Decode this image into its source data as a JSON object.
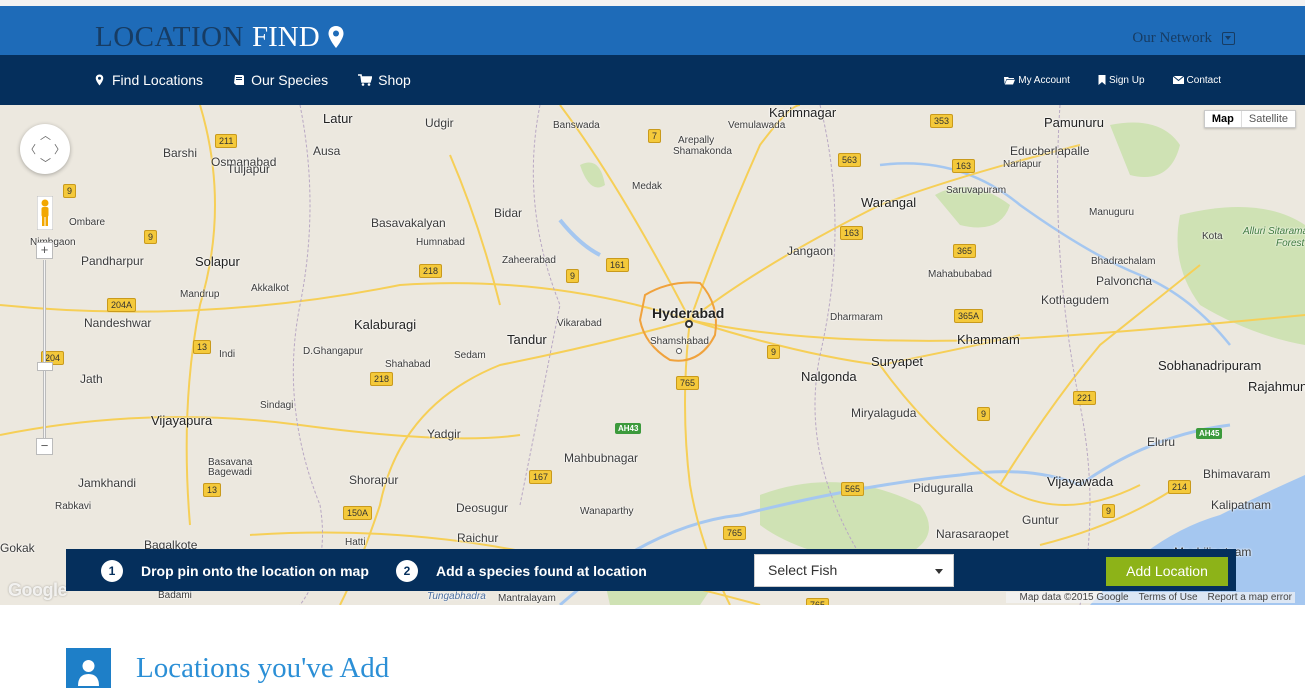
{
  "brand": {
    "part1": "LOCATION",
    "part2": "FIND",
    "icon": "map-marker-icon"
  },
  "header": {
    "network_label": "Our Network",
    "network_icon": "dropdown-box-icon"
  },
  "nav": {
    "left": [
      {
        "label": "Find Locations",
        "icon": "map-marker-icon"
      },
      {
        "label": "Our Species",
        "icon": "book-icon"
      },
      {
        "label": "Shop",
        "icon": "cart-icon"
      }
    ],
    "right": [
      {
        "label": "My Account",
        "icon": "folder-icon"
      },
      {
        "label": "Sign Up",
        "icon": "bookmark-icon"
      },
      {
        "label": "Contact",
        "icon": "envelope-icon"
      }
    ]
  },
  "map": {
    "type_buttons": [
      "Map",
      "Satellite"
    ],
    "attribution": [
      "Map data ©2015 Google",
      "Terms of Use",
      "Report a map error"
    ],
    "logo": "Google",
    "labels": [
      "Latur",
      "Udgir",
      "Banswada",
      "Karimnagar",
      "Vemulawada",
      "Pamunuru",
      "Barshi",
      "Osmanabad",
      "Ausa",
      "Arepally",
      "Shamakonda",
      "Educberlapalle",
      "Nariapur",
      "Tuljapur",
      "Medak",
      "Warangal",
      "Saruvapuram",
      "Ombare",
      "Basavakalyan",
      "Bidar",
      "Manuguru",
      "Nimbgaon",
      "Humnabad",
      "Jangaon",
      "Kota",
      "Alluri Sitarama",
      "Forest",
      "Pandharpur",
      "Solapur",
      "Zaheerabad",
      "Mahabubabad",
      "Bhadrachalam",
      "Mandrup",
      "Akkalkot",
      "Palvoncha",
      "Kothagudem",
      "Nandeshwar",
      "Kalaburagi",
      "Vikarabad",
      "Hyderabad",
      "Dharmaram",
      "Tandur",
      "Shamshabad",
      "Khammam",
      "Indi",
      "D.Ghangapur",
      "Sedam",
      "Suryapet",
      "Sobhanadripuram",
      "Shahabad",
      "Jath",
      "Nalgonda",
      "Rajahmundry",
      "Sindagi",
      "Miryalaguda",
      "Vijayapura",
      "Yadgir",
      "Eluru",
      "Basavana Bagewadi",
      "Mahbubnagar",
      "Bhimavaram",
      "Jamkhandi",
      "Shorapur",
      "Piduguralla",
      "Vijayawada",
      "Kalipatnam",
      "Rabkavi",
      "Deosugur",
      "Wanaparthy",
      "Guntur",
      "Gokak",
      "Raichur",
      "Narasaraopet",
      "Bagalkote",
      "Hatti",
      "Machilipatnam",
      "Badami",
      "Mantralayam",
      "Tungabhadra"
    ],
    "road_shields": [
      "211",
      "9",
      "7",
      "353",
      "563",
      "163",
      "163",
      "9",
      "218",
      "161",
      "9",
      "365",
      "204A",
      "365A",
      "13",
      "9",
      "204",
      "218",
      "765",
      "221",
      "9",
      "AH43",
      "167",
      "AH45",
      "13",
      "565",
      "214",
      "150A",
      "765",
      "9",
      "765"
    ]
  },
  "steps": [
    {
      "num": "1",
      "text": "Drop pin onto the location on map"
    },
    {
      "num": "2",
      "text": "Add a species found at location"
    }
  ],
  "select": {
    "value": "Select Fish"
  },
  "add_button": "Add Location",
  "section": {
    "title": "Locations you've Add",
    "icon": "user-icon"
  }
}
